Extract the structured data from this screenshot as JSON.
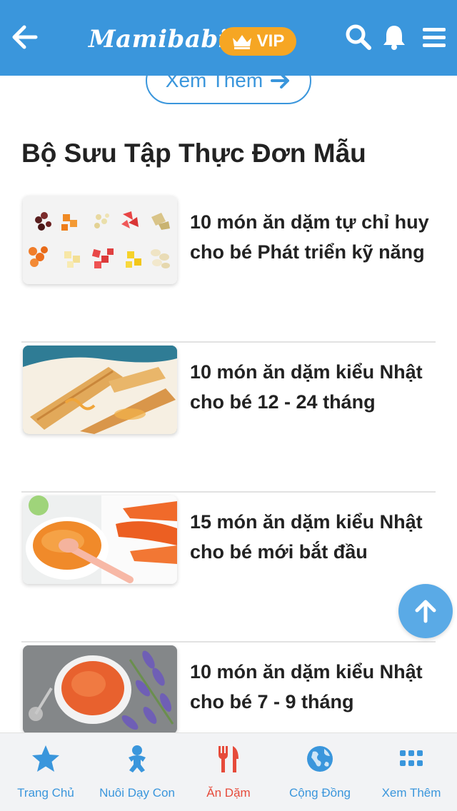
{
  "header": {
    "brand": "Mamibabi",
    "vip_label": "VIP",
    "colors": {
      "bar": "#3a96dc",
      "vip": "#f6a623"
    }
  },
  "content": {
    "more_button_label": "Xem Thêm",
    "section_title": "Bộ Sưu Tập Thực Đơn Mẫu",
    "items": [
      {
        "title": "10 món ăn dặm tự chỉ huy cho bé Phát triển kỹ năng",
        "thumbnail": "finger-food-fruits"
      },
      {
        "title": "10 món ăn dặm kiểu Nhật cho bé 12 - 24 tháng",
        "thumbnail": "rolled-crepes"
      },
      {
        "title": "15 món ăn dặm kiểu Nhật cho bé mới bắt đầu",
        "thumbnail": "carrot-puree"
      },
      {
        "title": "10 món ăn dặm kiểu Nhật cho bé 7 - 9 tháng",
        "thumbnail": "porridge-bowl"
      }
    ]
  },
  "bottom_nav": {
    "items": [
      {
        "label": "Trang Chủ",
        "icon": "star-icon",
        "active": false
      },
      {
        "label": "Nuôi Dạy Con",
        "icon": "baby-icon",
        "active": false
      },
      {
        "label": "Ăn Dặm",
        "icon": "fork-knife-icon",
        "active": true
      },
      {
        "label": "Cộng Đồng",
        "icon": "globe-icon",
        "active": false
      },
      {
        "label": "Xem Thêm",
        "icon": "grid-icon",
        "active": false
      }
    ],
    "colors": {
      "default": "#3a96dc",
      "active": "#e64b3b"
    }
  }
}
